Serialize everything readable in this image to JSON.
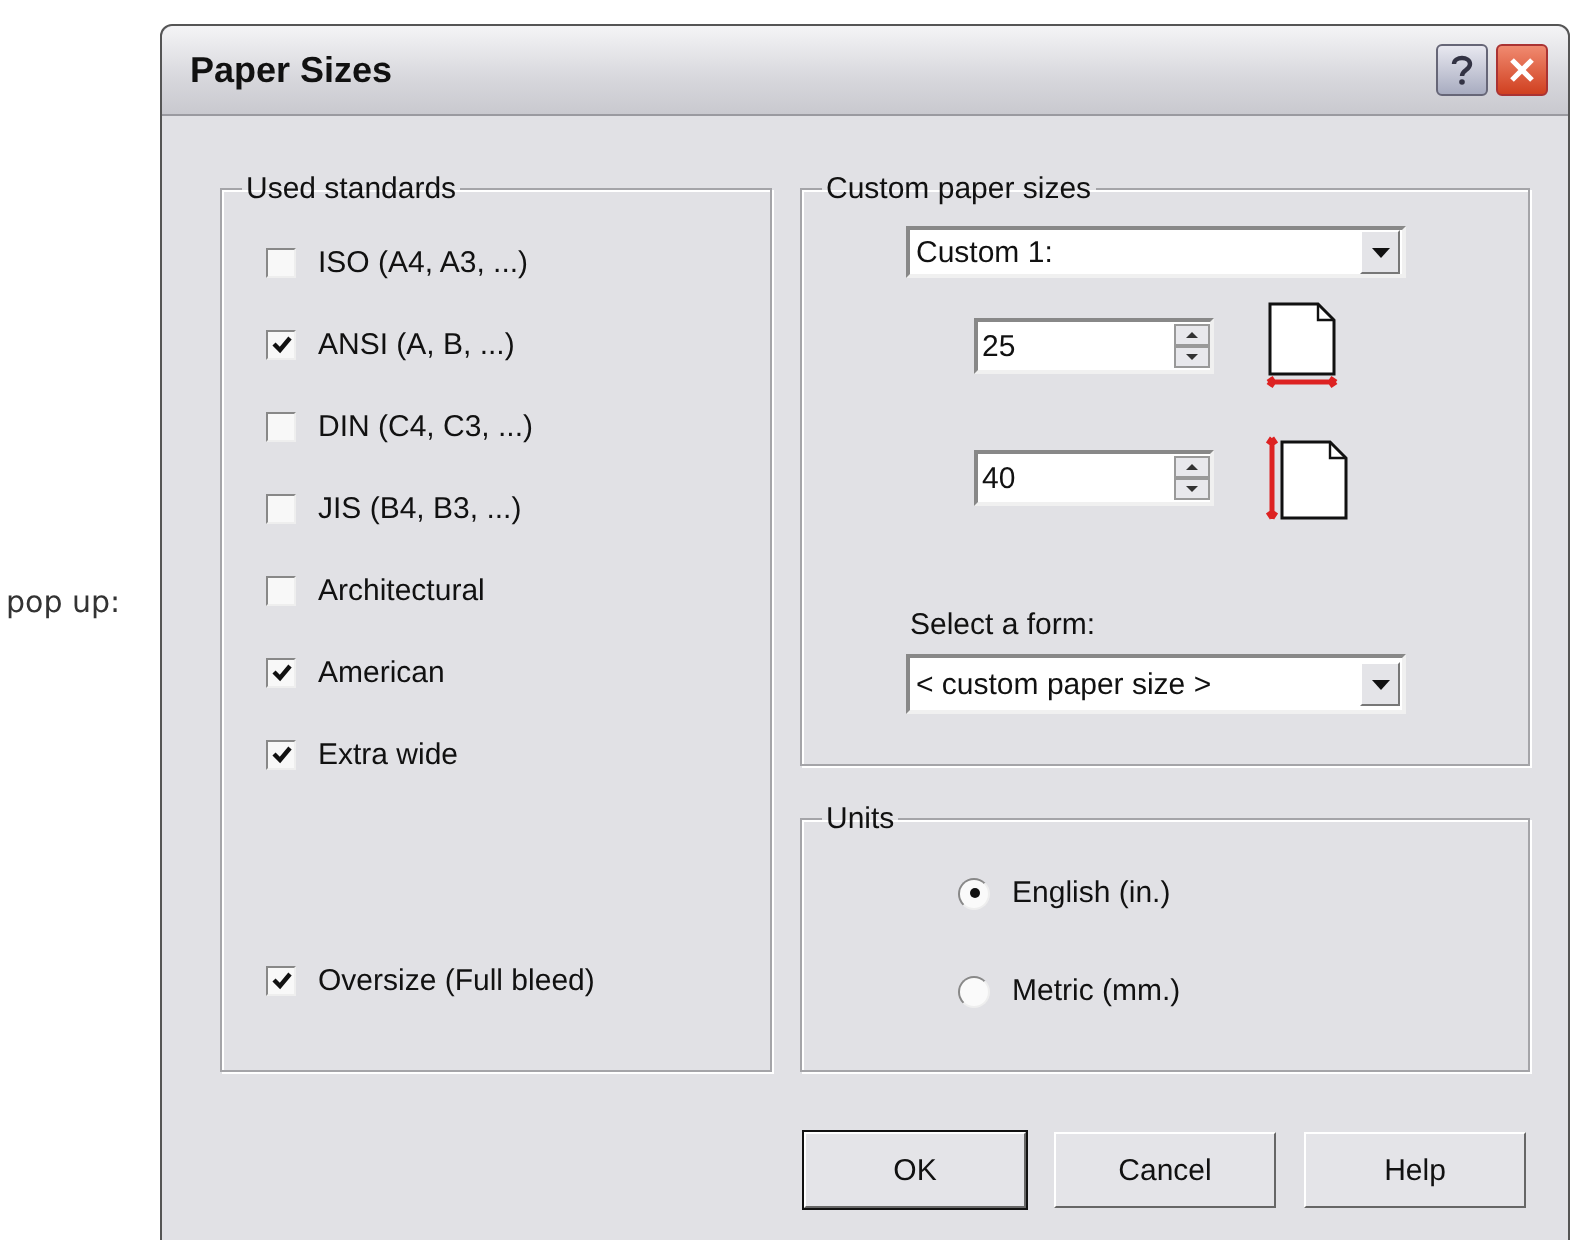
{
  "background": {
    "label": "pop up:"
  },
  "window": {
    "title": "Paper Sizes"
  },
  "used_standards": {
    "title": "Used standards",
    "items": [
      {
        "label": "ISO (A4, A3, ...)",
        "checked": false
      },
      {
        "label": "ANSI (A, B, ...)",
        "checked": true
      },
      {
        "label": "DIN (C4, C3, ...)",
        "checked": false
      },
      {
        "label": "JIS (B4, B3, ...)",
        "checked": false
      },
      {
        "label": "Architectural",
        "checked": false
      },
      {
        "label": "American",
        "checked": true
      },
      {
        "label": "Extra wide",
        "checked": true
      },
      {
        "label": "Oversize (Full bleed)",
        "checked": true
      }
    ]
  },
  "custom_paper_sizes": {
    "title": "Custom paper sizes",
    "preset": {
      "value": "Custom 1:"
    },
    "width": {
      "value": "25"
    },
    "height": {
      "value": "40"
    },
    "form_label": "Select a form:",
    "form": {
      "value": "< custom paper size >"
    }
  },
  "units": {
    "title": "Units",
    "options": [
      {
        "label": "English (in.)",
        "selected": true
      },
      {
        "label": "Metric (mm.)",
        "selected": false
      }
    ]
  },
  "buttons": [
    {
      "label": "OK",
      "default": true
    },
    {
      "label": "Cancel",
      "default": false
    },
    {
      "label": "Help",
      "default": false
    }
  ]
}
